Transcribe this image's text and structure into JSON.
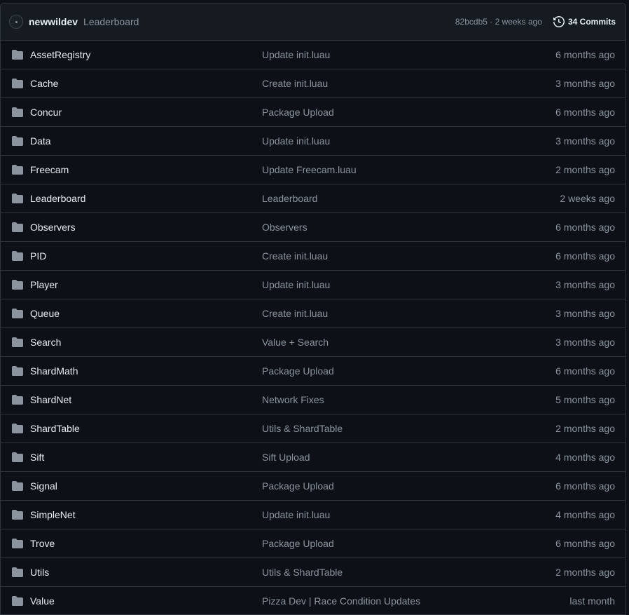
{
  "latest_commit": {
    "author": "newwildev",
    "message": "Leaderboard",
    "hash_and_time": "82bcdb5 · 2 weeks ago",
    "commits_label": "34 Commits"
  },
  "files": [
    {
      "name": "AssetRegistry",
      "message": "Update init.luau",
      "age": "6 months ago"
    },
    {
      "name": "Cache",
      "message": "Create init.luau",
      "age": "3 months ago"
    },
    {
      "name": "Concur",
      "message": "Package Upload",
      "age": "6 months ago"
    },
    {
      "name": "Data",
      "message": "Update init.luau",
      "age": "3 months ago"
    },
    {
      "name": "Freecam",
      "message": "Update Freecam.luau",
      "age": "2 months ago"
    },
    {
      "name": "Leaderboard",
      "message": "Leaderboard",
      "age": "2 weeks ago"
    },
    {
      "name": "Observers",
      "message": "Observers",
      "age": "6 months ago"
    },
    {
      "name": "PID",
      "message": "Create init.luau",
      "age": "6 months ago"
    },
    {
      "name": "Player",
      "message": "Update init.luau",
      "age": "3 months ago"
    },
    {
      "name": "Queue",
      "message": "Create init.luau",
      "age": "3 months ago"
    },
    {
      "name": "Search",
      "message": "Value + Search",
      "age": "3 months ago"
    },
    {
      "name": "ShardMath",
      "message": "Package Upload",
      "age": "6 months ago"
    },
    {
      "name": "ShardNet",
      "message": "Network Fixes",
      "age": "5 months ago"
    },
    {
      "name": "ShardTable",
      "message": "Utils & ShardTable",
      "age": "2 months ago"
    },
    {
      "name": "Sift",
      "message": "Sift Upload",
      "age": "4 months ago"
    },
    {
      "name": "Signal",
      "message": "Package Upload",
      "age": "6 months ago"
    },
    {
      "name": "SimpleNet",
      "message": "Update init.luau",
      "age": "4 months ago"
    },
    {
      "name": "Trove",
      "message": "Package Upload",
      "age": "6 months ago"
    },
    {
      "name": "Utils",
      "message": "Utils & ShardTable",
      "age": "2 months ago"
    },
    {
      "name": "Value",
      "message": "Pizza Dev | Race Condition Updates",
      "age": "last month"
    }
  ],
  "icons": {
    "folder": "folder-icon",
    "history": "history-icon",
    "avatar": "avatar"
  },
  "colors": {
    "background": "#0d1117",
    "header_background": "#161b22",
    "border": "#30363d",
    "text_primary": "#e6edf3",
    "text_muted": "#8b949e",
    "folder_icon": "#8b949e"
  }
}
